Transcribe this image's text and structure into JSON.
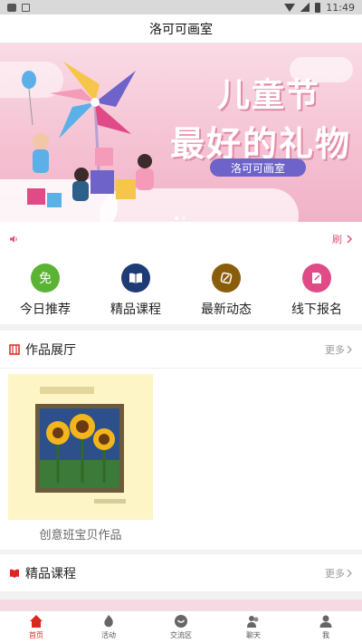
{
  "status_bar": {
    "time": "11:49"
  },
  "header": {
    "title": "洛可可画室"
  },
  "banner": {
    "headline_1": "儿童节",
    "headline_2": "最好的礼物",
    "pill": "洛可可画室"
  },
  "notice": {
    "right_label": "刷"
  },
  "quick_menu": [
    {
      "label": "今日推荐",
      "icon": "free-icon",
      "glyph": "免",
      "color": "#5bb333"
    },
    {
      "label": "精品课程",
      "icon": "book-icon",
      "glyph": "",
      "color": "#1e3b75"
    },
    {
      "label": "最新动态",
      "icon": "news-icon",
      "glyph": "",
      "color": "#8a5d0c"
    },
    {
      "label": "线下报名",
      "icon": "signup-icon",
      "glyph": "",
      "color": "#e04a86"
    }
  ],
  "gallery_section": {
    "title": "作品展厅",
    "more": "更多"
  },
  "gallery": [
    {
      "caption": "创意班宝贝作品"
    }
  ],
  "course_section": {
    "title": "精品课程",
    "more": "更多"
  },
  "tabs": [
    {
      "label": "首页",
      "icon": "home-icon",
      "active": true
    },
    {
      "label": "活动",
      "icon": "activity-icon",
      "active": false
    },
    {
      "label": "交流区",
      "icon": "chat-bubble-icon",
      "active": false
    },
    {
      "label": "聊天",
      "icon": "people-icon",
      "active": false
    },
    {
      "label": "我",
      "icon": "user-icon",
      "active": false
    }
  ],
  "colors": {
    "accent": "#d9281f",
    "pink": "#e8526f",
    "banner_pill": "#6d63c9"
  }
}
